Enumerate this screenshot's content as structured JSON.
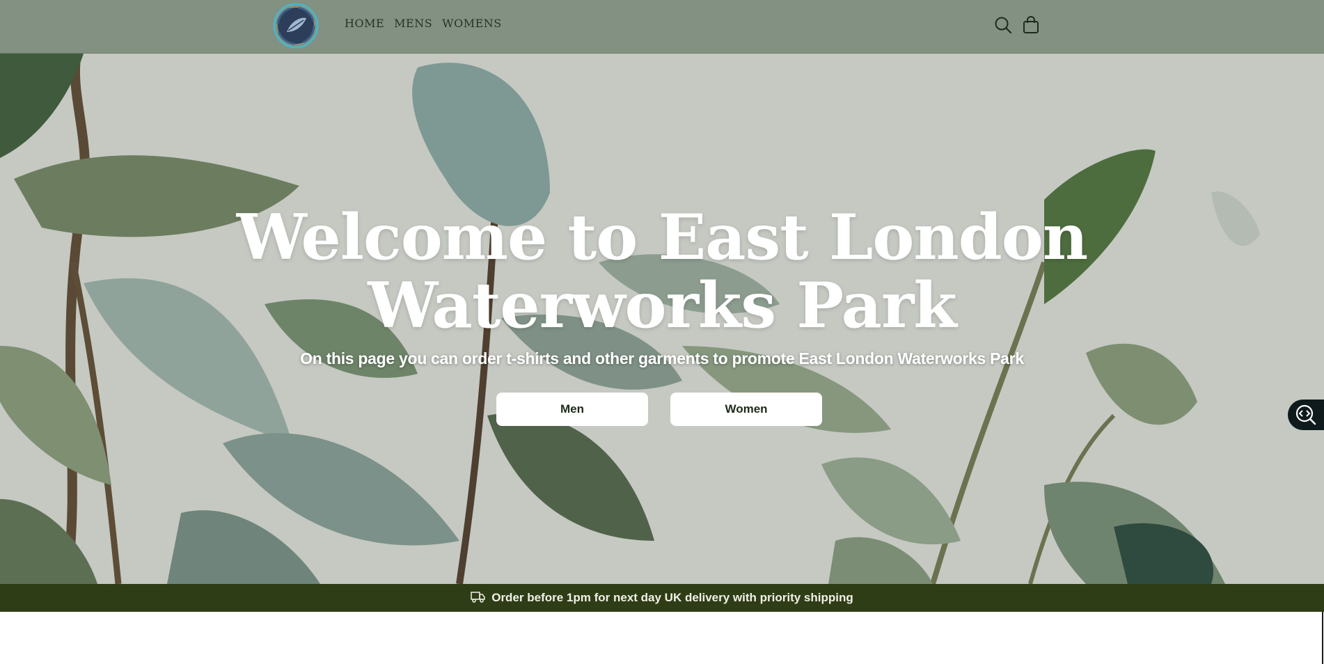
{
  "header": {
    "logo_icon": "leaf-logo-icon",
    "nav": [
      {
        "label": "HOME"
      },
      {
        "label": "MENS"
      },
      {
        "label": "WOMENS"
      }
    ],
    "search_icon": "search-icon",
    "cart_icon": "shopping-bag-icon"
  },
  "hero": {
    "title_line1": "Welcome to East London",
    "title_line2": "Waterworks Park",
    "subtitle": "On this page you can order t-shirts and other garments to promote East London Waterworks Park",
    "buttons": [
      {
        "label": "Men"
      },
      {
        "label": "Women"
      }
    ],
    "side_widget_icon": "code-search-icon"
  },
  "announcement": {
    "icon": "delivery-truck-icon",
    "text": "Order before 1pm for next day UK delivery with priority shipping"
  },
  "colors": {
    "header_bg": "#829181",
    "announcement_bg": "#2f3d16",
    "hero_bg": "#c6c9c3"
  }
}
